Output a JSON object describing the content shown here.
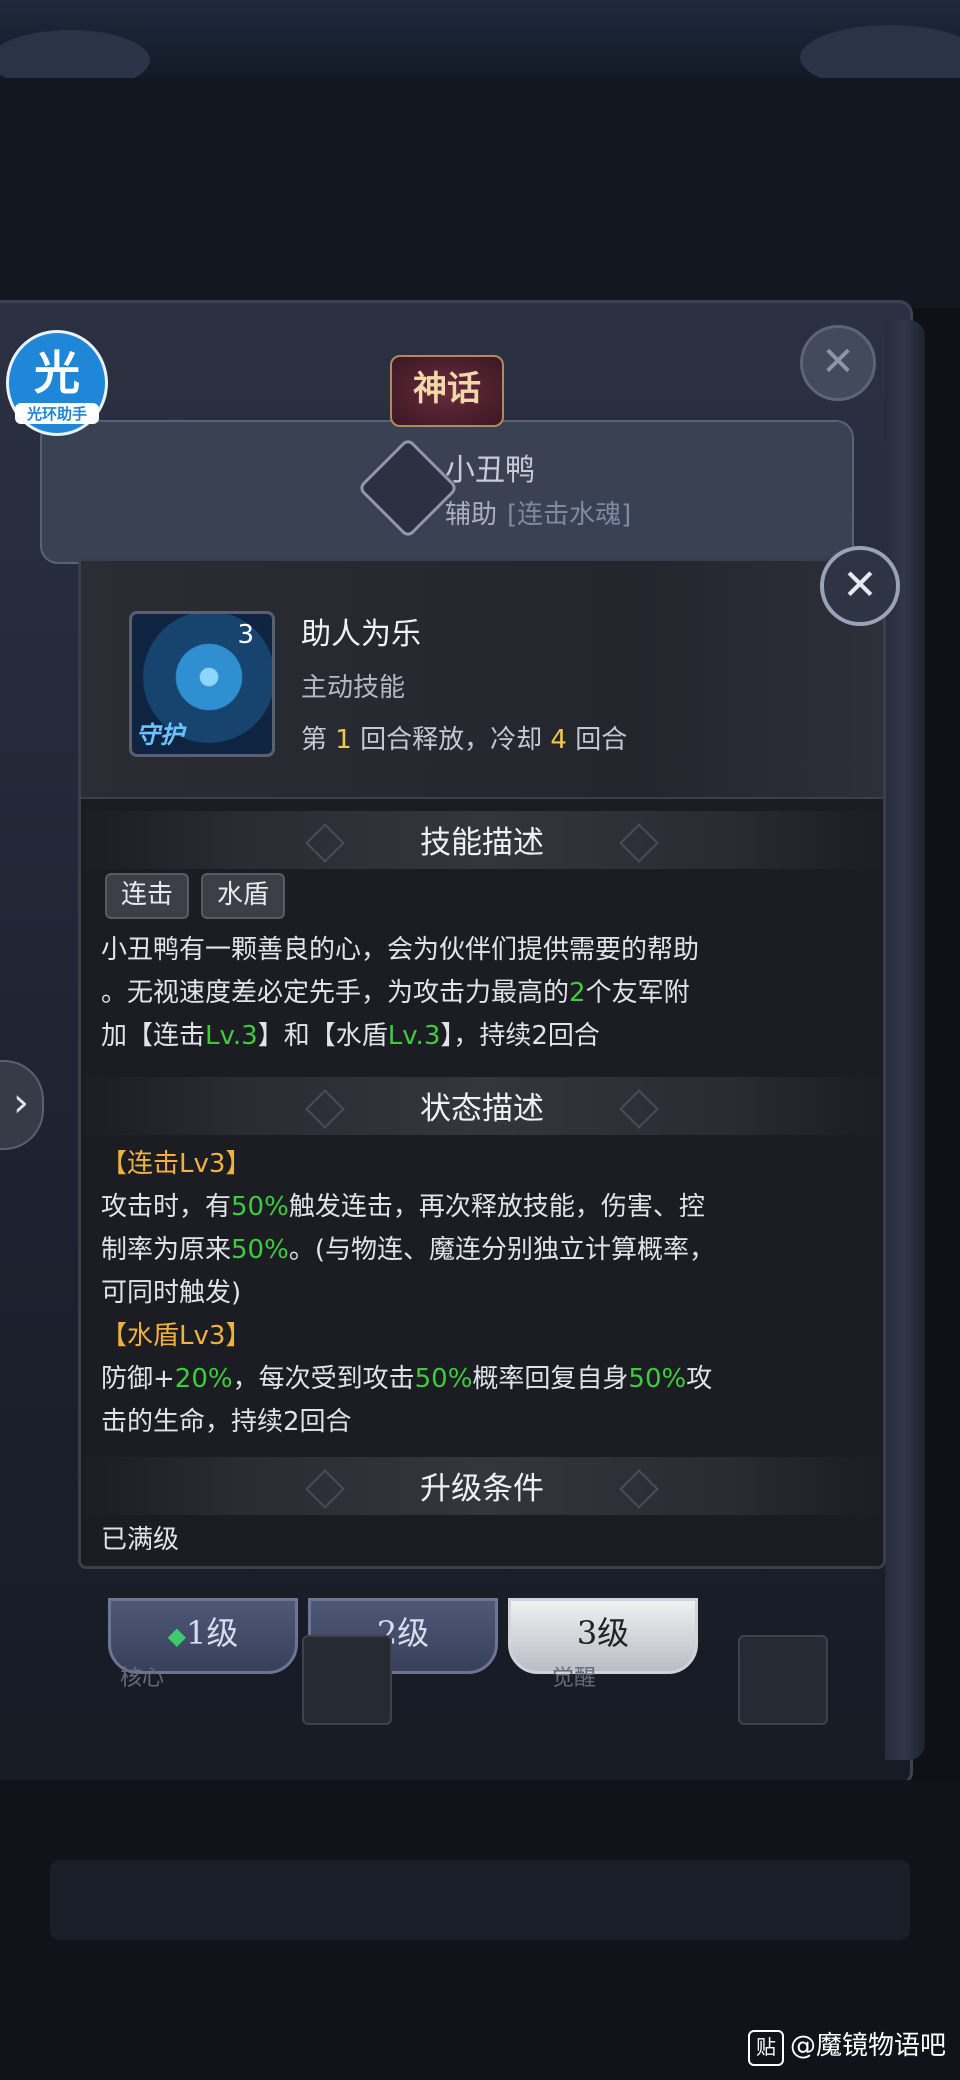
{
  "app_logo": {
    "big": "光",
    "small": "光环助手"
  },
  "character": {
    "badge": "神话",
    "name": "小丑鸭",
    "role": "辅助",
    "role_tag": "[连击水魂]"
  },
  "skill": {
    "name": "助人为乐",
    "type": "主动技能",
    "cd_prefix": "第",
    "cd_round": "1",
    "cd_mid": "回合释放，冷却",
    "cd_value": "4",
    "cd_suffix": "回合",
    "icon_level": "3",
    "icon_label": "守护"
  },
  "sections": {
    "skill_desc": "技能描述",
    "state_desc": "状态描述",
    "upgrade": "升级条件"
  },
  "tags": [
    "连击",
    "水盾"
  ],
  "description": {
    "p1": "小丑鸭有一颗善良的心，会为伙伴们提供需要的帮助",
    "p2a": "。无视速度差必定先手，为攻击力最高的",
    "p2b": "2",
    "p2c": "个友军附",
    "p3a": "加【连击",
    "p3b": "Lv.3",
    "p3c": "】和【水盾",
    "p3d": "Lv.3",
    "p3e": "】，持续2回合"
  },
  "states": {
    "combo_title": "【连击Lv3】",
    "combo_l1a": "攻击时，有",
    "combo_l1b": "50%",
    "combo_l1c": "触发连击，再次释放技能，伤害、控",
    "combo_l2a": "制率为原来",
    "combo_l2b": "50%",
    "combo_l2c": "。(与物连、魔连分别独立计算概率，",
    "combo_l3": "可同时触发)",
    "shield_title": "【水盾Lv3】",
    "shield_l1a": "防御+",
    "shield_l1b": "20%",
    "shield_l1c": "，每次受到攻击",
    "shield_l1d": "50%",
    "shield_l1e": "概率回复自身",
    "shield_l1f": "50%",
    "shield_l1g": "攻",
    "shield_l2": "击的生命，持续2回合"
  },
  "upgrade_text": "已满级",
  "level_tabs": [
    "1级",
    "2级",
    "3级"
  ],
  "sub_labels": {
    "left": "核心",
    "right": "觉醒"
  },
  "close_glyph": "✕",
  "back_close_glyph": "✕",
  "left_arrow_glyph": "›",
  "watermark": {
    "icon": "贴",
    "text": "@魔镜物语吧"
  }
}
